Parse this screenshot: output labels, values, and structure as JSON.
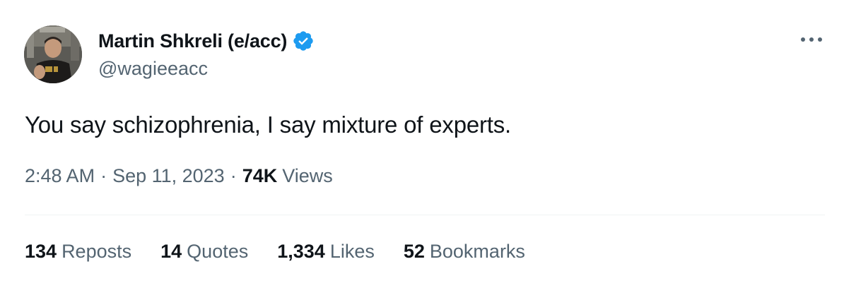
{
  "author": {
    "display_name": "Martin Shkreli (e/acc)",
    "handle": "@wagieeacc",
    "verified": true,
    "verified_color": "#1d9bf0",
    "avatar_icon": "profile-photo"
  },
  "tweet": {
    "text": "You say schizophrenia, I say mixture of experts.",
    "time": "2:48 AM",
    "separator": "·",
    "date": "Sep 11, 2023",
    "views_count": "74K",
    "views_label": "Views"
  },
  "stats": [
    {
      "count": "134",
      "label": "Reposts"
    },
    {
      "count": "14",
      "label": "Quotes"
    },
    {
      "count": "1,334",
      "label": "Likes"
    },
    {
      "count": "52",
      "label": "Bookmarks"
    }
  ],
  "icons": {
    "more": "more-horizontal-icon",
    "verified": "verified-badge-icon"
  },
  "colors": {
    "text_primary": "#0f1419",
    "text_secondary": "#536471",
    "divider": "#eff3f4"
  }
}
